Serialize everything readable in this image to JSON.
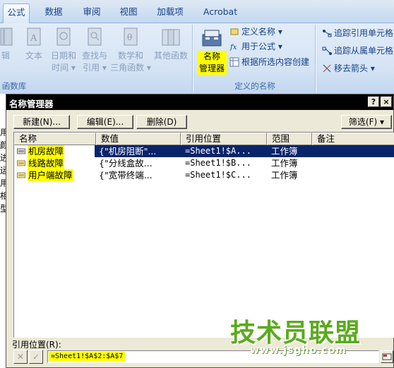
{
  "ribbon": {
    "tabs": [
      "公式",
      "数据",
      "审阅",
      "视图",
      "加载项",
      "Acrobat"
    ],
    "active_tab": "公式",
    "function_library": {
      "buttons": [
        {
          "line1": "辑",
          "line2": ""
        },
        {
          "line1": "文本",
          "line2": ""
        },
        {
          "line1": "日期和",
          "line2": "时间"
        },
        {
          "line1": "查找与",
          "line2": "引用"
        },
        {
          "line1": "数学和",
          "line2": "三角函数"
        },
        {
          "line1": "其他函数",
          "line2": ""
        }
      ],
      "label": "函数库"
    },
    "defined_names": {
      "name_manager_line1": "名称",
      "name_manager_line2": "管理器",
      "define_name": "定义名称",
      "use_in_formula": "用于公式",
      "create_from_selection": "根据所选内容创建",
      "label": "定义的名称"
    },
    "formula_auditing": {
      "trace_precedents": "追踪引用单元格",
      "trace_dependents": "追踪从属单元格",
      "remove_arrows": "移去箭头"
    }
  },
  "sheet": {
    "chars": [
      "用",
      "颜",
      "进",
      "运",
      "用",
      "相",
      "型"
    ]
  },
  "dialog": {
    "title": "名称管理器",
    "help": "?",
    "close": "×",
    "buttons": {
      "new": "新建(N)...",
      "edit": "编辑(E)...",
      "delete": "删除(D)",
      "filter": "筛选(F)"
    },
    "columns": [
      "名称",
      "数值",
      "引用位置",
      "范围",
      "备注"
    ],
    "rows": [
      {
        "name": "机房故障",
        "value": "{\"机房阻断\"...",
        "ref": "=Sheet1!$A...",
        "scope": "工作簿",
        "comment": "",
        "selected": true
      },
      {
        "name": "线路故障",
        "value": "{\"分线盒故...",
        "ref": "=Sheet1!$B...",
        "scope": "工作簿",
        "comment": "",
        "selected": false
      },
      {
        "name": "用户端故障",
        "value": "{\"宽带终端...",
        "ref": "=Sheet1!$C...",
        "scope": "工作簿",
        "comment": "",
        "selected": false
      }
    ],
    "refers_to_label": "引用位置(R):",
    "refers_to_value": "=Sheet1!$A$2:$A$7"
  },
  "watermark": {
    "cn": "技术员联盟",
    "url": "www.jsgho.com"
  },
  "colors": {
    "highlight": "#ffff00",
    "selection": "#0a246a",
    "ribbon_text": "#15428b",
    "watermark": "#5aab1c"
  }
}
